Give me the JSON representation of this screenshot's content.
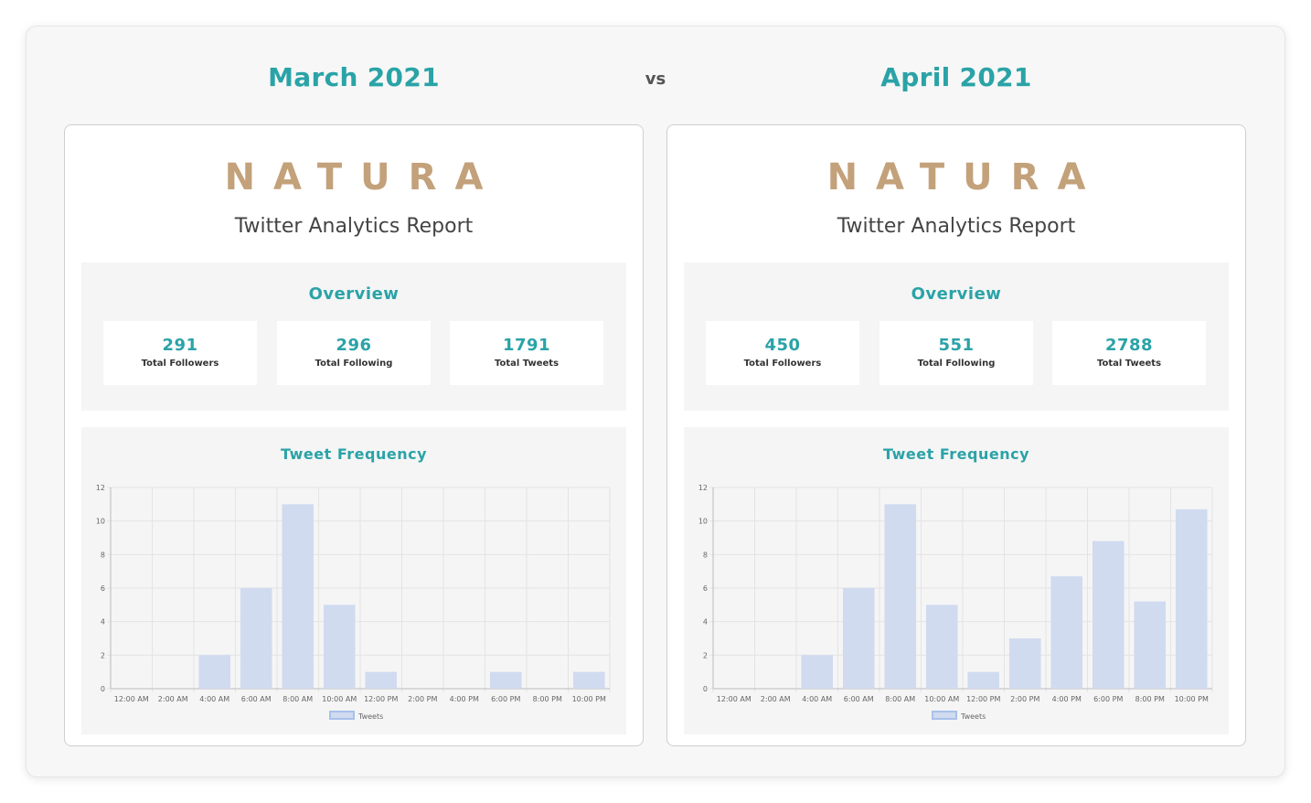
{
  "header": {
    "left_month": "March 2021",
    "vs": "vs",
    "right_month": "April 2021"
  },
  "reports": [
    {
      "logo": "NATURA",
      "title": "Twitter Analytics Report",
      "overview": {
        "title": "Overview",
        "stats": [
          {
            "value": "291",
            "label": "Total Followers"
          },
          {
            "value": "296",
            "label": "Total Following"
          },
          {
            "value": "1791",
            "label": "Total Tweets"
          }
        ]
      },
      "frequency": {
        "title": "Tweet Frequency",
        "chart_data": {
          "type": "bar",
          "categories": [
            "12:00 AM",
            "2:00 AM",
            "4:00 AM",
            "6:00 AM",
            "8:00 AM",
            "10:00 AM",
            "12:00 PM",
            "2:00 PM",
            "4:00 PM",
            "6:00 PM",
            "8:00 PM",
            "10:00 PM"
          ],
          "series": [
            {
              "name": "Tweets",
              "values": [
                0,
                0,
                2,
                6,
                11,
                5,
                1,
                0,
                0,
                1,
                0,
                1
              ]
            }
          ],
          "ylim": [
            0,
            12
          ],
          "yticks": [
            0,
            2,
            4,
            6,
            8,
            10,
            12
          ],
          "grid": true,
          "legend": "bottom",
          "bar_color": "#d0dbf0",
          "legend_color": "#a9c1ea"
        }
      }
    },
    {
      "logo": "NATURA",
      "title": "Twitter Analytics Report",
      "overview": {
        "title": "Overview",
        "stats": [
          {
            "value": "450",
            "label": "Total Followers"
          },
          {
            "value": "551",
            "label": "Total Following"
          },
          {
            "value": "2788",
            "label": "Total Tweets"
          }
        ]
      },
      "frequency": {
        "title": "Tweet Frequency",
        "chart_data": {
          "type": "bar",
          "categories": [
            "12:00 AM",
            "2:00 AM",
            "4:00 AM",
            "6:00 AM",
            "8:00 AM",
            "10:00 AM",
            "12:00 PM",
            "2:00 PM",
            "4:00 PM",
            "6:00 PM",
            "8:00 PM",
            "10:00 PM"
          ],
          "series": [
            {
              "name": "Tweets",
              "values": [
                0,
                0,
                2,
                6,
                11,
                5,
                1,
                3,
                6.7,
                8.8,
                5.2,
                10.7
              ]
            }
          ],
          "ylim": [
            0,
            12
          ],
          "yticks": [
            0,
            2,
            4,
            6,
            8,
            10,
            12
          ],
          "grid": true,
          "legend": "bottom",
          "bar_color": "#d0dbf0",
          "legend_color": "#a9c1ea"
        }
      }
    }
  ]
}
